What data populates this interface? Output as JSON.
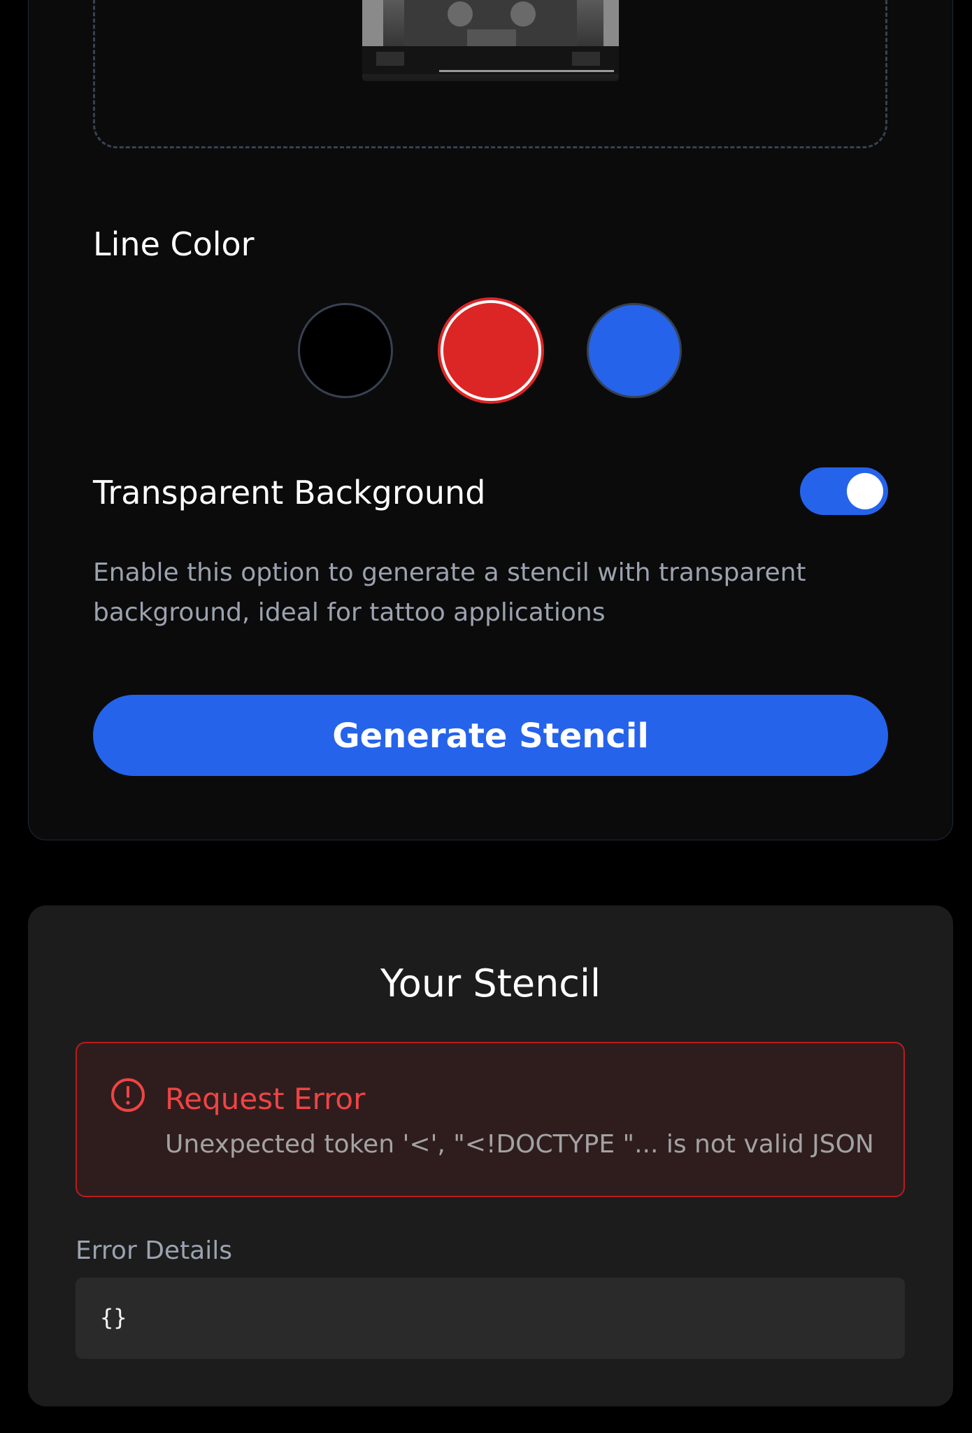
{
  "settings": {
    "preview_image_icon": "stencil-preview-image",
    "line_color_label": "Line Color",
    "line_colors": [
      {
        "name": "black",
        "hex": "#000000",
        "selected": false
      },
      {
        "name": "red",
        "hex": "#dc2626",
        "selected": true
      },
      {
        "name": "blue",
        "hex": "#2563eb",
        "selected": false
      }
    ],
    "transparent_background_label": "Transparent Background",
    "transparent_background_enabled": true,
    "help_text": "Enable this option to generate a stencil with transparent background, ideal for tattoo applications",
    "generate_button_label": "Generate Stencil"
  },
  "result": {
    "title": "Your Stencil",
    "error": {
      "icon": "alert-circle-icon",
      "title": "Request Error",
      "message": "Unexpected token '<', \"<!DOCTYPE \"... is not valid JSON"
    },
    "details_label": "Error Details",
    "details_value": "{}"
  },
  "colors": {
    "accent": "#2563eb",
    "error": "#ef4444",
    "background": "#000000",
    "card": "#0b0b0c",
    "result_card": "#1c1c1d"
  }
}
